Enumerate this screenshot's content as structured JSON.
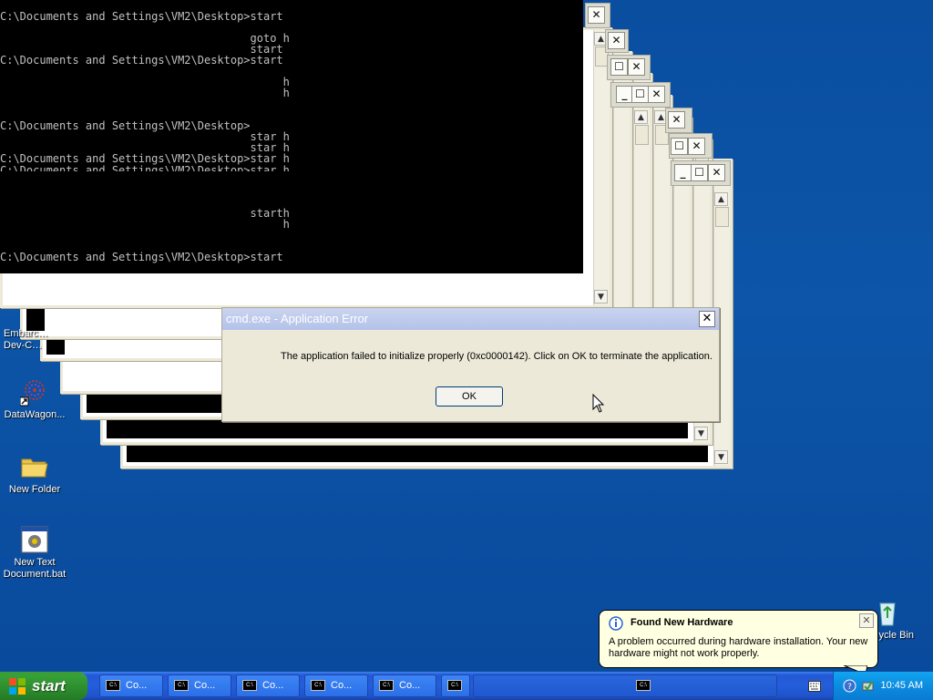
{
  "console": {
    "lines": [
      "C:\\Documents and Settings\\VM2\\Desktop>start",
      "",
      "                                      goto h",
      "                                      start",
      "C:\\Documents and Settings\\VM2\\Desktop>start",
      "",
      "                                           h",
      "                                           h",
      "",
      "",
      "C:\\Documents and Settings\\VM2\\Desktop>",
      "                                      star h",
      "                                      star h",
      "C:\\Documents and Settings\\VM2\\Desktop>star h",
      "",
      "",
      "",
      "",
      "                                      starth",
      "                                           h",
      "",
      "",
      "C:\\Documents and Settings\\VM2\\Desktop>start"
    ],
    "overlap_line": "C:\\Documents and Settings\\VM2\\Desktop>star h"
  },
  "dialog": {
    "title": "cmd.exe - Application Error",
    "message": "The application failed to initialize properly (0xc0000142). Click on OK to terminate the application.",
    "ok_label": "OK",
    "close_glyph": "✕"
  },
  "desktop_icons": [
    {
      "label": "Embarc… Dev-C…",
      "icon": "embarcadero-icon"
    },
    {
      "label": "DataWagon...",
      "icon": "datawagon-icon"
    },
    {
      "label": "New Folder",
      "icon": "folder-icon"
    },
    {
      "label": "New Text Document.bat",
      "icon": "batch-file-icon"
    },
    {
      "label": "Recycle Bin",
      "icon": "recycle-bin-icon"
    }
  ],
  "balloon": {
    "title": "Found New Hardware",
    "body": "A problem occurred during hardware installation. Your new hardware might not work properly.",
    "close_glyph": "✕"
  },
  "taskbar": {
    "start_label": "start",
    "tasks": [
      "Co...",
      "Co...",
      "Co...",
      "Co...",
      "Co...",
      ""
    ],
    "clock": "10:45 AM"
  },
  "colors": {
    "desktop": "#0b4f9f",
    "taskbar": "#245edb",
    "start": "#2d8c2d",
    "tray": "#0b8ce0",
    "balloon": "#ffffe1"
  }
}
